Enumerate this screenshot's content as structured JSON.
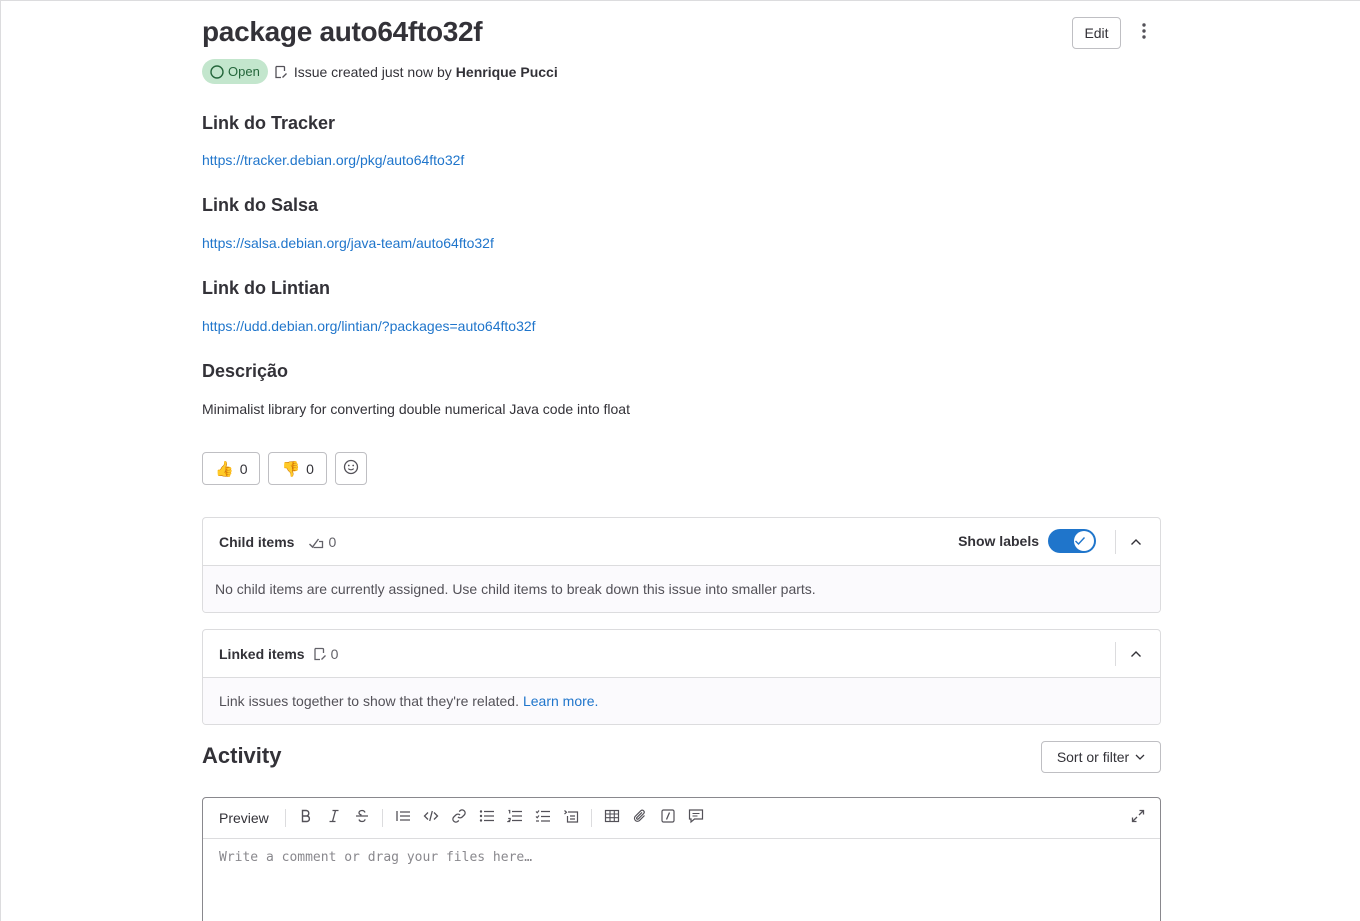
{
  "issue": {
    "title": "package auto64fto32f",
    "status": "Open",
    "created_text": "Issue created just now by",
    "author": "Henrique Pucci",
    "edit_label": "Edit",
    "status_color": "#c3e6cd"
  },
  "description": {
    "sections": [
      {
        "heading": "Link do Tracker",
        "link": "https://tracker.debian.org/pkg/auto64fto32f"
      },
      {
        "heading": "Link do Salsa",
        "link": "https://salsa.debian.org/java-team/auto64fto32f"
      },
      {
        "heading": "Link do Lintian",
        "link": "https://udd.debian.org/lintian/?packages=auto64fto32f"
      },
      {
        "heading": "Descrição",
        "text": "Minimalist library for converting double numerical Java code into float"
      }
    ]
  },
  "reactions": {
    "thumbs_up": {
      "emoji": "👍",
      "count": "0"
    },
    "thumbs_down": {
      "emoji": "👎",
      "count": "0"
    }
  },
  "child_items": {
    "title": "Child items",
    "count": "0",
    "show_labels": "Show labels",
    "show_labels_on": true,
    "empty_text": "No child items are currently assigned. Use child items to break down this issue into smaller parts."
  },
  "linked_items": {
    "title": "Linked items",
    "count": "0",
    "empty_text": "Link issues together to show that they're related.",
    "learn_more": "Learn more."
  },
  "activity": {
    "title": "Activity",
    "sort_label": "Sort or filter",
    "editor": {
      "preview_label": "Preview",
      "placeholder": "Write a comment or drag your files here…"
    }
  },
  "colors": {
    "link": "#1f75cb",
    "toggle": "#1f75cb"
  }
}
